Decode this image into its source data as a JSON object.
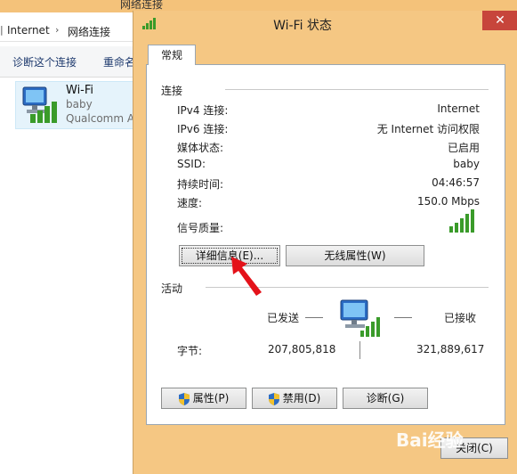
{
  "background_window": {
    "title": "网络连接",
    "breadcrumb": [
      "Internet",
      "网络连接"
    ],
    "toolbar": [
      "诊断这个连接",
      "重命名"
    ],
    "item": {
      "name": "Wi-Fi",
      "ssid": "baby",
      "adapter": "Qualcomm At"
    }
  },
  "dialog": {
    "title": "Wi-Fi 状态",
    "close_glyph": "✕",
    "tab": "常规",
    "connection": {
      "label": "连接",
      "rows": [
        {
          "key": "IPv4 连接:",
          "value": "Internet"
        },
        {
          "key": "IPv6 连接:",
          "value": "无 Internet 访问权限"
        },
        {
          "key": "媒体状态:",
          "value": "已启用"
        },
        {
          "key": "SSID:",
          "value": "baby"
        },
        {
          "key": "持续时间:",
          "value": "04:46:57"
        },
        {
          "key": "速度:",
          "value": "150.0 Mbps"
        }
      ],
      "signal_label": "信号质量:",
      "signal_bars": 5
    },
    "buttons": {
      "details": "详细信息(E)...",
      "wireless": "无线属性(W)"
    },
    "activity": {
      "label": "活动",
      "sent": "已发送",
      "received": "已接收",
      "bytes_label": "字节:",
      "bytes_sent": "207,805,818",
      "bytes_received": "321,889,617"
    },
    "bottom_buttons": {
      "properties": "属性(P)",
      "disable": "禁用(D)",
      "diagnose": "诊断(G)"
    },
    "close_label": "关闭(C)",
    "watermark": "Bai经验"
  },
  "colors": {
    "titlebar": "#f5c783",
    "close": "#c7453b",
    "signal": "#3a9b2a",
    "arrow": "#e4121a"
  },
  "icons": [
    "wifi-signal-icon",
    "network-computer-icon",
    "uac-shield-icon",
    "chevron-right-icon"
  ]
}
